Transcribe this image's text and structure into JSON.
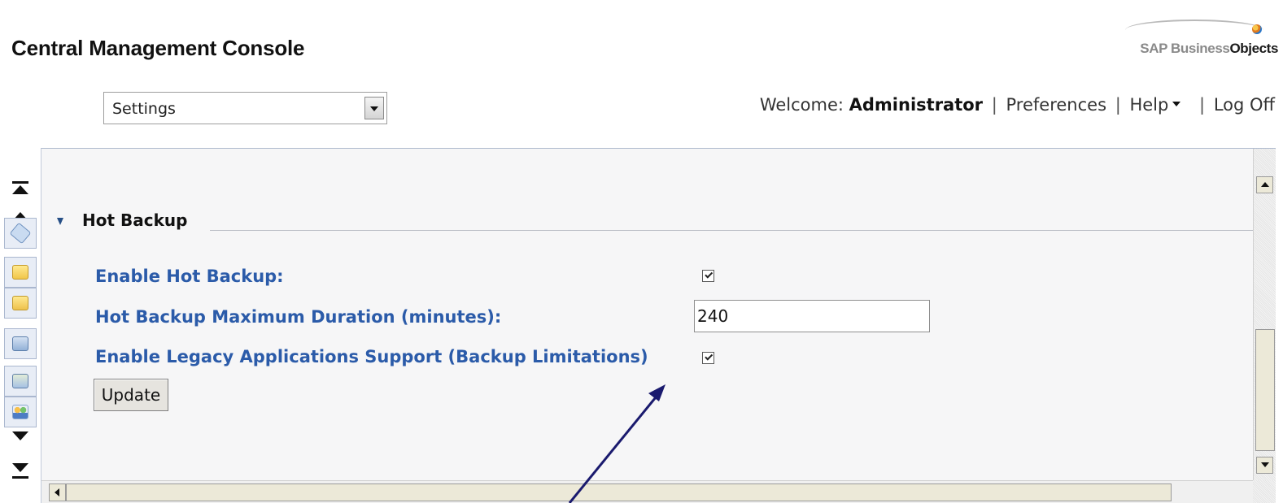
{
  "header": {
    "app_title": "Central Management Console",
    "logo_text_light": "SAP Business",
    "logo_text_bold": "Objects",
    "view_select": {
      "value": "Settings"
    },
    "welcome_label": "Welcome:",
    "user_name": "Administrator",
    "separator": "|",
    "preferences_link": "Preferences",
    "help_link": "Help",
    "logoff_link": "Log Off"
  },
  "left_rail": {
    "icons": [
      "tags-icon",
      "folder-icon",
      "favorites-folder-icon",
      "folders-icon",
      "inbox-icon",
      "users-icon"
    ]
  },
  "section": {
    "title": "Hot Backup",
    "expanded": true,
    "fields": [
      {
        "label": "Enable Hot Backup:",
        "type": "checkbox",
        "checked": true
      },
      {
        "label": "Hot Backup Maximum Duration (minutes):",
        "type": "text",
        "value": "240"
      },
      {
        "label": "Enable Legacy Applications Support (Backup Limitations)",
        "type": "checkbox",
        "checked": true
      }
    ],
    "update_button": "Update"
  },
  "colors": {
    "field_label": "#2b5ba9",
    "panel_bg": "#f6f6f7",
    "arrow": "#1a1a6e"
  }
}
